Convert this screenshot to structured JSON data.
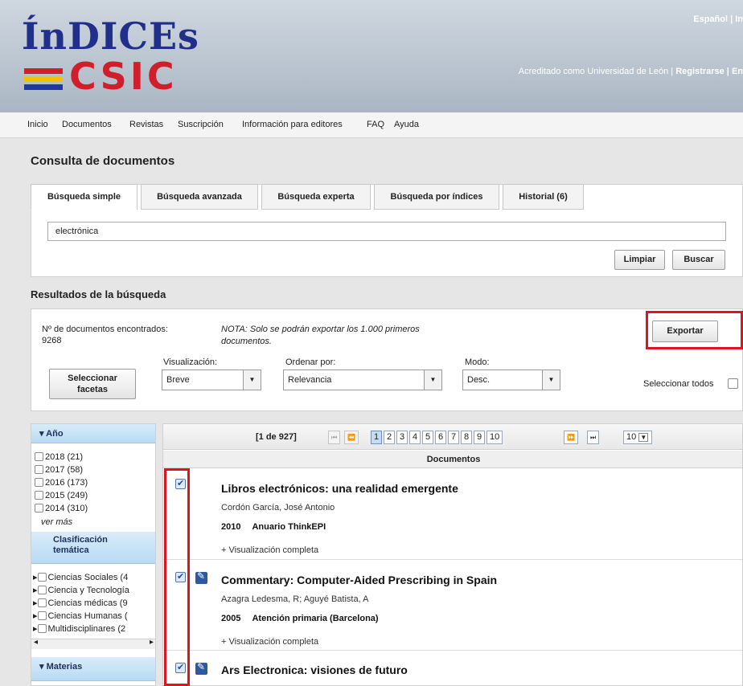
{
  "header": {
    "logo_top": "ÍnDICEs",
    "logo_bottom": "CSIC",
    "lang": "Español | In",
    "account_text": "Acreditado como Universidad de León |",
    "register": "Registrarse | En",
    "stripe_colors": [
      "#d01f2b",
      "#f2c200",
      "#1f3a9a"
    ]
  },
  "nav": [
    "Inicio",
    "Documentos",
    "Revistas",
    "Suscripción",
    "Información para editores",
    "FAQ",
    "Ayuda"
  ],
  "page_title": "Consulta de documentos",
  "tabs": [
    "Búsqueda simple",
    "Búsqueda avanzada",
    "Búsqueda experta",
    "Búsqueda por índices",
    "Historial (6)"
  ],
  "search": {
    "value": "electrónica",
    "clear_label": "Limpiar",
    "search_label": "Buscar"
  },
  "results_title": "Resultados de la búsqueda",
  "results": {
    "found_label": "Nº de documentos encontrados:",
    "found_count": "9268",
    "note_line1": "NOTA: Solo se podrán exportar los 1.000 primeros",
    "note_line2": "documentos.",
    "export_label": "Exportar",
    "facets_line1": "Seleccionar",
    "facets_line2": "facetas",
    "view_label": "Visualización:",
    "view_value": "Breve",
    "sort_label": "Ordenar por:",
    "sort_value": "Relevancia",
    "mode_label": "Modo:",
    "mode_value": "Desc.",
    "select_all": "Seleccionar todos"
  },
  "sidebar": {
    "year_head": "Año",
    "years": [
      "2018 (21)",
      "2017 (58)",
      "2016 (173)",
      "2015 (249)",
      "2014 (310)"
    ],
    "more": "ver más",
    "class_head_1": "Clasificación",
    "class_head_2": "temática",
    "classes": [
      "Ciencias Sociales (4",
      "Ciencia y Tecnología",
      "Ciencias médicas (9",
      "Ciencias Humanas (",
      "Multidisciplinares (2"
    ],
    "next_head": "Materias"
  },
  "pager": {
    "range": "[1 de 927]",
    "pages": [
      "1",
      "2",
      "3",
      "4",
      "5",
      "6",
      "7",
      "8",
      "9",
      "10"
    ],
    "per_page": "10",
    "first": "⏮",
    "prev": "⏪",
    "next": "⏩",
    "last": "⏭"
  },
  "docs_header": "Documentos",
  "documents": [
    {
      "title": "Libros electrónicos: una realidad emergente",
      "author": "Cordón García, José Antonio",
      "year": "2010",
      "source": "Anuario ThinkEPI",
      "more": "+ Visualización completa"
    },
    {
      "title": "Commentary: Computer-Aided Prescribing in Spain",
      "author": "Azagra Ledesma, R; Aguyé Batista, A",
      "year": "2005",
      "source": "Atención primaria (Barcelona)",
      "more": "+ Visualización completa"
    },
    {
      "title": "Ars Electronica: visiones de futuro"
    }
  ]
}
